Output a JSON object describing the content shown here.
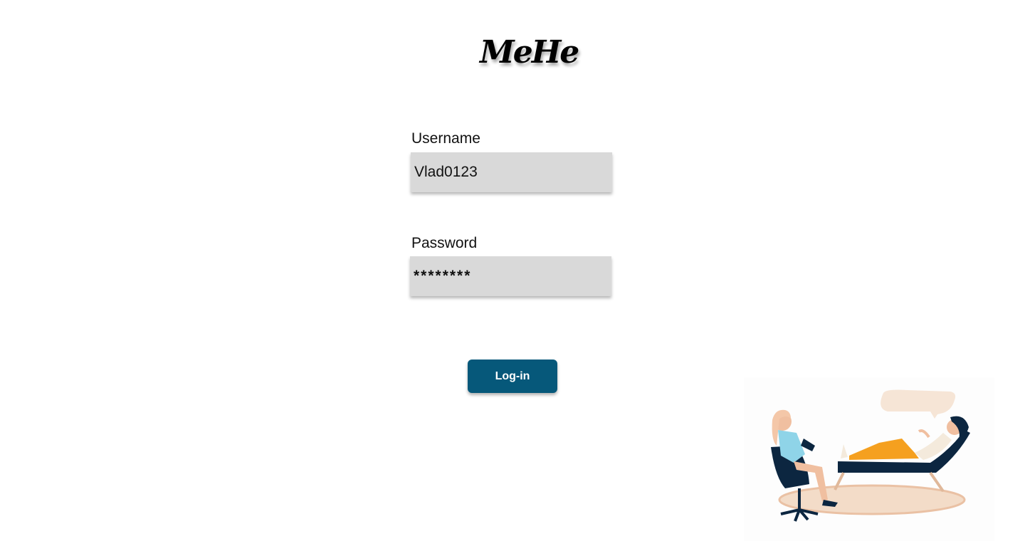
{
  "app": {
    "logo_text": "MeHe"
  },
  "login_form": {
    "username_label": "Username",
    "username_value": "Vlad0123",
    "password_label": "Password",
    "password_value": "********",
    "submit_label": "Log-in"
  },
  "illustration": {
    "icon": "therapy-session-illustration"
  },
  "colors": {
    "button_bg": "#06587a",
    "field_bg": "#d9d9d9",
    "accent_orange": "#f5a01f",
    "navy": "#0c2640"
  }
}
